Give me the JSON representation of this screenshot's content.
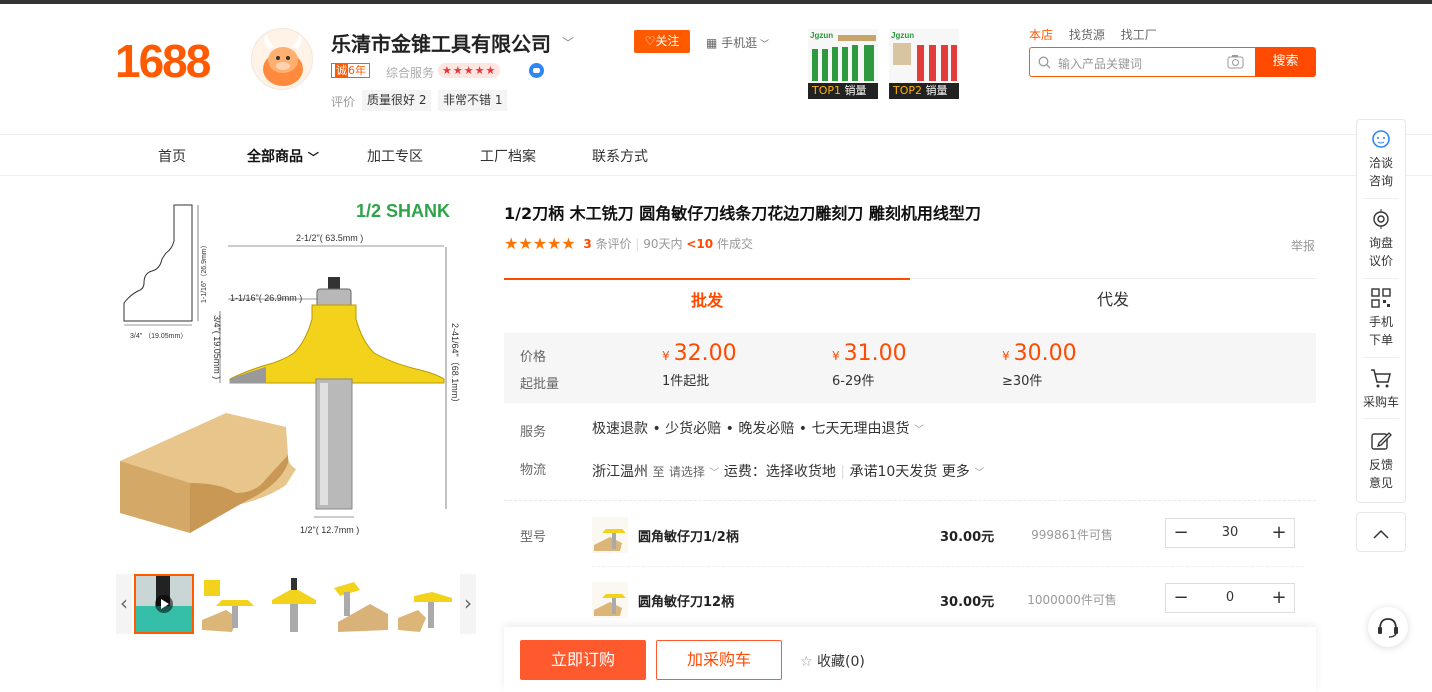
{
  "header": {
    "logo": "1688",
    "shop_name": "乐清市金锥工具有限公司",
    "years_badge_prefix": "诚",
    "years_badge": "6年",
    "service_label": "综合服务",
    "service_stars": "★★★★★",
    "eval_label": "评价",
    "eval_tags": [
      {
        "label": "质量很好",
        "count": "2"
      },
      {
        "label": "非常不错",
        "count": "1"
      }
    ],
    "follow_label": "关注",
    "mobile_label": "手机逛",
    "promos": [
      {
        "brand": "Jgzun",
        "badge_top": "TOP1",
        "badge_text": "销量"
      },
      {
        "brand": "Jgzun",
        "badge_top": "TOP2",
        "badge_text": "销量"
      }
    ],
    "search_tabs": [
      "本店",
      "找货源",
      "找工厂"
    ],
    "search_placeholder": "输入产品关键词",
    "search_button": "搜索"
  },
  "nav": {
    "items": [
      "首页",
      "全部商品",
      "加工专区",
      "工厂档案",
      "联系方式"
    ]
  },
  "gallery": {
    "shank_label": "1/2 SHANK",
    "dims": {
      "top_width": "2-1/2\"( 63.5mm )",
      "inner_width": "1-1/16\"( 26.9mm )",
      "height_left": "3/4\"( 19.05mm )",
      "height_right": "2-41/64\"（68.1mm）",
      "shank": "1/2\"( 12.7mm )",
      "profile_height": "1-1/16\"（26.9mm）",
      "profile_base": "3/4\" （19.05mm）"
    }
  },
  "product": {
    "title": "1/2刀柄 木工铣刀 圆角敏仔刀线条刀花边刀雕刻刀 雕刻机用线型刀",
    "stars": "★★★★★",
    "review_count": "3",
    "review_suffix": "条评价",
    "sales_prefix": "90天内",
    "sales_value": "<10",
    "sales_suffix": "件成交",
    "report": "举报",
    "tabs": [
      "批发",
      "代发"
    ],
    "price_label": "价格",
    "moq_label": "起批量",
    "currency": "¥",
    "price_tiers": [
      {
        "price": "32.00",
        "moq": "1件起批"
      },
      {
        "price": "31.00",
        "moq": "6-29件"
      },
      {
        "price": "30.00",
        "moq": "≥30件"
      }
    ],
    "service_label": "服务",
    "service_text": "极速退款 • 少货必赔 • 晚发必赔 • 七天无理由退货",
    "logistics_label": "物流",
    "logistics_from": "浙江温州",
    "logistics_to": "至",
    "logistics_select": "请选择",
    "logistics_fee": "运费：选择收货地",
    "logistics_promise": "承诺10天发货",
    "logistics_more": "更多",
    "model_label": "型号",
    "skus": [
      {
        "name": "圆角敏仔刀1/2柄",
        "price": "30.00元",
        "stock": "999861件可售",
        "qty": "30"
      },
      {
        "name": "圆角敏仔刀12柄",
        "price": "30.00元",
        "stock": "1000000件可售",
        "qty": "0"
      }
    ]
  },
  "actions": {
    "buy_now": "立即订购",
    "add_cart": "加采购车",
    "favorite": "收藏(0)"
  },
  "sidebar": {
    "items": [
      "洽谈\n咨询",
      "询盘\n议价",
      "手机\n下单",
      "采购车",
      "反馈\n意见"
    ]
  },
  "colors": {
    "accent": "#ff4a00",
    "logo": "#ff5a00"
  }
}
